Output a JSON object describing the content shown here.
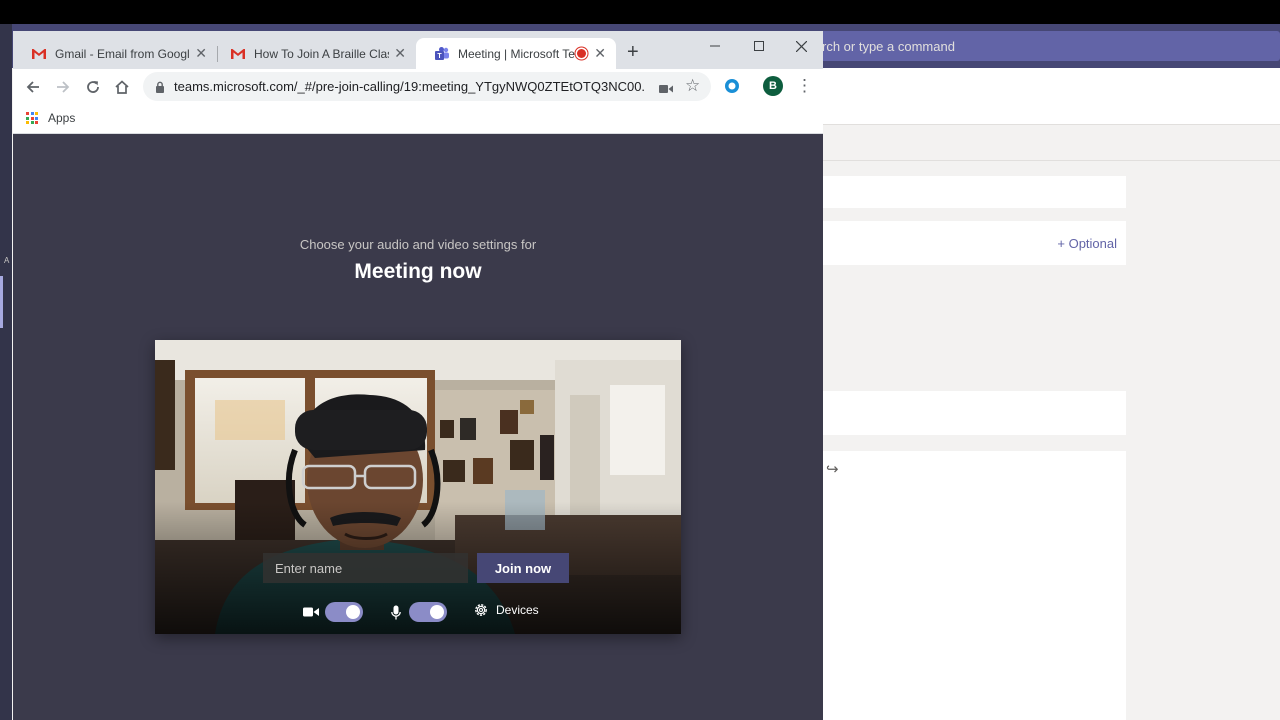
{
  "background_app": {
    "search_placeholder": "rch or type a command",
    "optional_label": "+ Optional",
    "rail_text": "A"
  },
  "browser": {
    "tabs": [
      {
        "title": "Gmail - Email from Google",
        "icon": "gmail-icon"
      },
      {
        "title": "How To Join A Braille Class -",
        "icon": "gmail-icon"
      },
      {
        "title": "Meeting | Microsoft Tea",
        "icon": "teams-icon",
        "active": true,
        "recording": true
      }
    ],
    "url": "teams.microsoft.com/_#/pre-join-calling/19:meeting_YTgyNWQ0ZTEtOTQ3NC00...",
    "profile_initial": "B",
    "bookmarks": [
      {
        "label": "Apps",
        "icon": "apps-grid-icon"
      }
    ]
  },
  "prejoin": {
    "subtitle": "Choose your audio and video settings for",
    "title": "Meeting now",
    "name_placeholder": "Enter name",
    "join_label": "Join now",
    "camera_on": true,
    "mic_on": true,
    "devices_label": "Devices"
  },
  "colors": {
    "teams_purple": "#6264a7",
    "teams_dark": "#464775",
    "stage_bg": "#3b3a4b",
    "toggle_on": "#8b8cc7"
  }
}
